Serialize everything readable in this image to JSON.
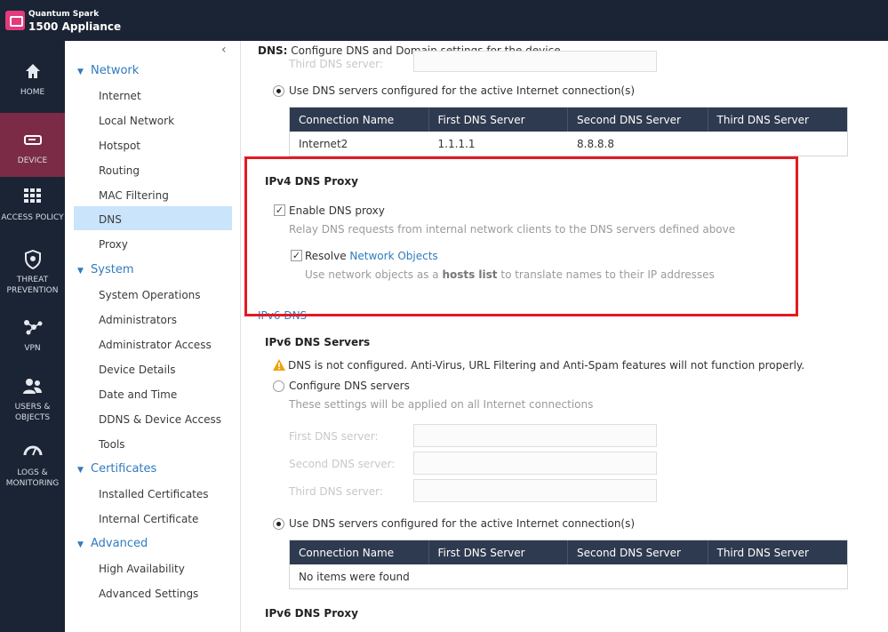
{
  "header": {
    "product_line1": "Quantum Spark",
    "product_line2": "1500 Appliance"
  },
  "rail": [
    {
      "label": "HOME",
      "icon": "home-icon"
    },
    {
      "label": "DEVICE",
      "icon": "device-icon",
      "active": true
    },
    {
      "label": "ACCESS POLICY",
      "icon": "grid-icon"
    },
    {
      "label": "THREAT PREVENTION",
      "icon": "shield-icon"
    },
    {
      "label": "VPN",
      "icon": "vpn-icon"
    },
    {
      "label": "USERS & OBJECTS",
      "icon": "users-icon"
    },
    {
      "label": "LOGS & MONITORING",
      "icon": "gauge-icon"
    }
  ],
  "sidebar": {
    "collapse_glyph": "‹",
    "sections": [
      {
        "title": "Network",
        "items": [
          "Internet",
          "Local Network",
          "Hotspot",
          "Routing",
          "MAC Filtering",
          "DNS",
          "Proxy"
        ]
      },
      {
        "title": "System",
        "items": [
          "System Operations",
          "Administrators",
          "Administrator Access",
          "Device Details",
          "Date and Time",
          "DDNS & Device Access",
          "Tools"
        ]
      },
      {
        "title": "Certificates",
        "items": [
          "Installed Certificates",
          "Internal Certificate"
        ]
      },
      {
        "title": "Advanced",
        "items": [
          "High Availability",
          "Advanced Settings"
        ]
      }
    ],
    "selected": "DNS"
  },
  "page": {
    "title_prefix": "DNS:",
    "title_text": "Configure DNS and Domain settings for the device",
    "ipv4_third_dns_label": "Third DNS server:",
    "ipv4_use_active_label": "Use DNS servers configured for the active Internet connection(s)",
    "table_headers": [
      "Connection Name",
      "First DNS Server",
      "Second DNS Server",
      "Third DNS Server"
    ],
    "ipv4_rows": [
      [
        "Internet2",
        "1.1.1.1",
        "8.8.8.8",
        ""
      ]
    ],
    "ipv4_proxy": {
      "title": "IPv4 DNS Proxy",
      "enable_label": "Enable DNS proxy",
      "enable_desc": "Relay DNS requests from internal network clients to the DNS servers defined above",
      "resolve_label": "Resolve",
      "resolve_link": "Network Objects",
      "resolve_desc_pre": "Use network objects as a",
      "resolve_desc_bold": "hosts list",
      "resolve_desc_post": "to translate names to their IP addresses"
    },
    "ipv6_section": "IPv6 DNS",
    "ipv6_servers_title": "IPv6 DNS Servers",
    "ipv6_warning": "DNS is not configured. Anti-Virus, URL Filtering and Anti-Spam features will not function properly.",
    "ipv6_configure_label": "Configure DNS servers",
    "ipv6_configure_desc": "These settings will be applied on all Internet connections",
    "ipv6_first_label": "First DNS server:",
    "ipv6_second_label": "Second DNS server:",
    "ipv6_third_label": "Third DNS server:",
    "ipv6_use_active_label": "Use DNS servers configured for the active Internet connection(s)",
    "ipv6_empty": "No items were found",
    "ipv6_proxy_title": "IPv6 DNS Proxy"
  }
}
